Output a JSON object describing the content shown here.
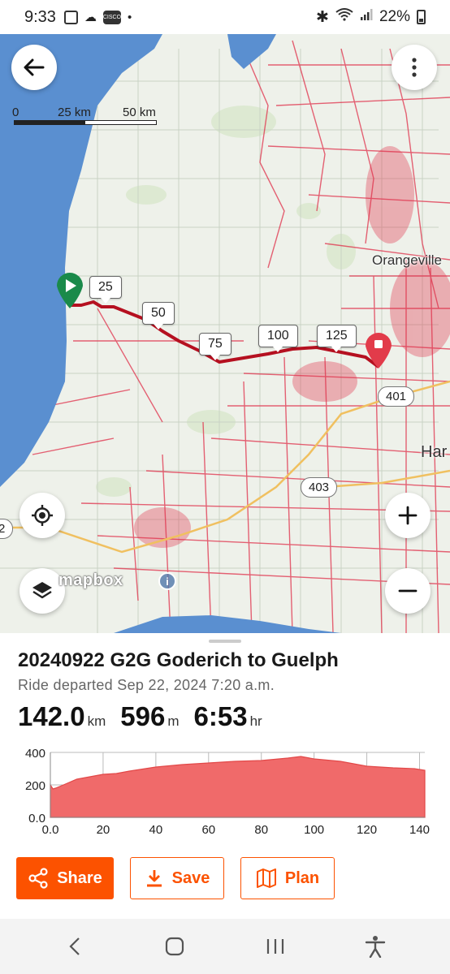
{
  "status_bar": {
    "time": "9:33",
    "cisco_label": "CISCO",
    "battery": "22%"
  },
  "map": {
    "scale": {
      "labels": [
        "0",
        "25 km",
        "50 km"
      ]
    },
    "km_markers": [
      "25",
      "50",
      "75",
      "100",
      "125"
    ],
    "place_labels": [
      "Orangeville",
      "Har"
    ],
    "highway_shields": [
      "401",
      "403",
      "2"
    ],
    "attribution": "mapbox",
    "colors": {
      "route": "#c8102e",
      "heatmap": "#e0304a",
      "water": "#5a8fd0",
      "land": "#eef1ea",
      "start": "#1a8a4a",
      "end": "#e23b4a"
    }
  },
  "ride": {
    "title": "20240922 G2G Goderich to Guelph",
    "subtitle": "Ride departed Sep 22, 2024 7:20 a.m.",
    "stats": [
      {
        "value": "142.0",
        "unit": "km"
      },
      {
        "value": "596",
        "unit": "m"
      },
      {
        "value": "6:53",
        "unit": "hr"
      }
    ]
  },
  "chart_data": {
    "type": "area",
    "title": "",
    "xlabel": "",
    "ylabel": "",
    "x_ticks": [
      "0.0",
      "20",
      "40",
      "60",
      "80",
      "100",
      "120",
      "140"
    ],
    "y_ticks": [
      "400",
      "200",
      "0.0"
    ],
    "xlim": [
      0,
      142
    ],
    "ylim": [
      0,
      400
    ],
    "grid": true,
    "color": "#f06a6a",
    "series": [
      {
        "x": [
          0,
          1,
          2,
          5,
          10,
          15,
          20,
          25,
          30,
          40,
          50,
          60,
          70,
          80,
          90,
          95,
          100,
          110,
          120,
          130,
          138,
          142
        ],
        "values": [
          200,
          175,
          180,
          200,
          235,
          250,
          265,
          270,
          285,
          310,
          325,
          335,
          345,
          350,
          365,
          375,
          360,
          345,
          315,
          305,
          300,
          290
        ]
      }
    ]
  },
  "actions": {
    "share": "Share",
    "save": "Save",
    "plan": "Plan"
  }
}
